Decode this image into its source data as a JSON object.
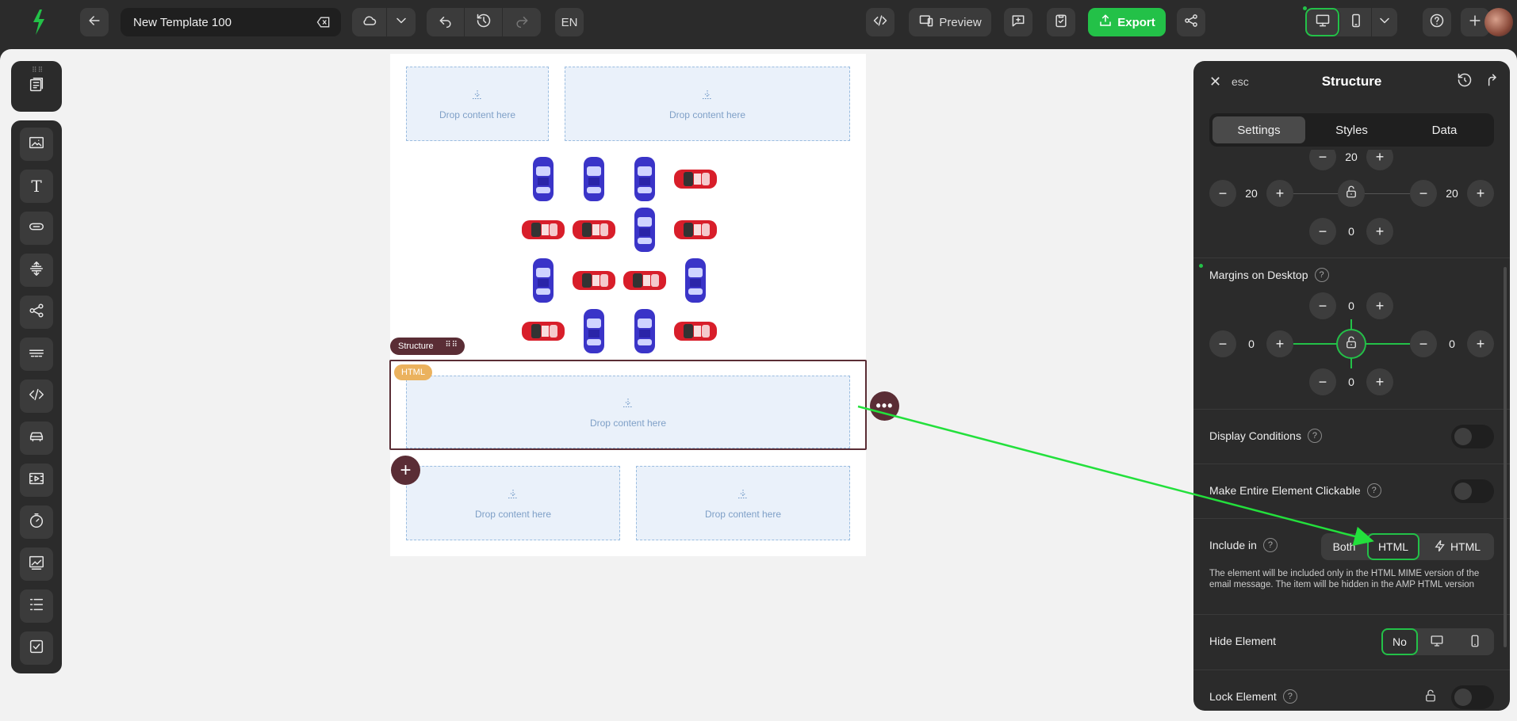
{
  "app": {
    "template_title": "New Template 100",
    "language": "EN",
    "preview_label": "Preview",
    "export_label": "Export"
  },
  "canvas": {
    "drop_text": "Drop content here",
    "structure_label": "Structure",
    "html_tag": "HTML",
    "more_label": "•••",
    "add_label": "+"
  },
  "panel": {
    "esc_label": "esc",
    "title": "Structure",
    "tabs": [
      "Settings",
      "Styles",
      "Data"
    ],
    "padding": {
      "top": "20",
      "left": "20",
      "right": "20",
      "bottom": "0"
    },
    "margins_label": "Margins on Desktop",
    "margins": {
      "top": "0",
      "left": "0",
      "right": "0",
      "bottom": "0"
    },
    "display_conditions_label": "Display Conditions",
    "clickable_label": "Make Entire Element Clickable",
    "include_label": "Include in",
    "include_options": [
      "Both",
      "HTML",
      "HTML"
    ],
    "include_selected": "HTML",
    "include_desc": "The element will be included only in the HTML MIME version of the email message. The item will be hidden in the AMP HTML version",
    "hide_label": "Hide Element",
    "hide_no": "No",
    "lock_label": "Lock Element",
    "help_mark": "?"
  },
  "colors": {
    "accent": "#23c148",
    "structure": "#5a2d35",
    "html_tag": "#ebb25e"
  }
}
